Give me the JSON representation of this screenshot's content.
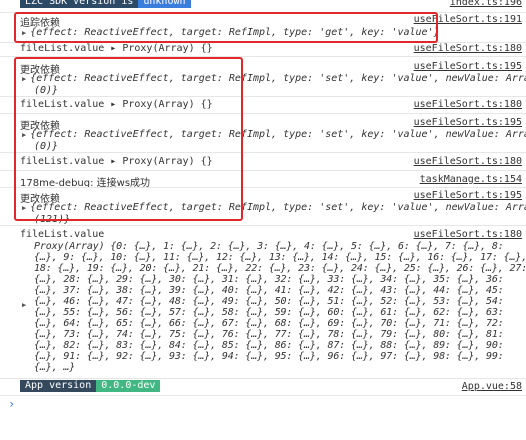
{
  "sdk_banner": {
    "label": "LZC SDK Version is",
    "value": "unknown",
    "link": "index.ts:196"
  },
  "logs": [
    {
      "label": "追踪依赖",
      "obj": "{effect: ReactiveEffect, target: RefImpl, type: 'get', key: 'value'}",
      "link": "useFileSort.ts:191"
    },
    {
      "text": "fileList.value ▸ Proxy(Array) {}",
      "link": "useFileSort.ts:180"
    },
    {
      "label": "更改依赖",
      "obj": "{effect: ReactiveEffect, target: RefImpl, type: 'set', key: 'value', newValue: Array",
      "obj2": "(0)}",
      "link": "useFileSort.ts:195"
    },
    {
      "text": "fileList.value ▸ Proxy(Array) {}",
      "link": "useFileSort.ts:180"
    },
    {
      "label": "更改依赖",
      "obj": "{effect: ReactiveEffect, target: RefImpl, type: 'set', key: 'value', newValue: Array",
      "obj2": "(0)}",
      "link": "useFileSort.ts:195"
    },
    {
      "text": "fileList.value ▸ Proxy(Array) {}",
      "link": "useFileSort.ts:180"
    },
    {
      "text": "178me-debug: 连接ws成功",
      "link": "taskManage.ts:154"
    },
    {
      "label": "更改依赖",
      "obj": "{effect: ReactiveEffect, target: RefImpl, type: 'set', key: 'value', newValue: Array",
      "obj2": "(121)}",
      "link": "useFileSort.ts:195"
    },
    {
      "label": "fileList.value",
      "link": "useFileSort.ts:180"
    }
  ],
  "proxy_lines": [
    "Proxy(Array) {0: {…}, 1: {…}, 2: {…}, 3: {…}, 4: {…}, 5: {…}, 6: {…}, 7: {…}, 8:",
    "{…}, 9: {…}, 10: {…}, 11: {…}, 12: {…}, 13: {…}, 14: {…}, 15: {…}, 16: {…}, 17: {…},",
    "18: {…}, 19: {…}, 20: {…}, 21: {…}, 22: {…}, 23: {…}, 24: {…}, 25: {…}, 26: {…}, 27:",
    "{…}, 28: {…}, 29: {…}, 30: {…}, 31: {…}, 32: {…}, 33: {…}, 34: {…}, 35: {…}, 36:",
    "{…}, 37: {…}, 38: {…}, 39: {…}, 40: {…}, 41: {…}, 42: {…}, 43: {…}, 44: {…}, 45:",
    "{…}, 46: {…}, 47: {…}, 48: {…}, 49: {…}, 50: {…}, 51: {…}, 52: {…}, 53: {…}, 54:",
    "{…}, 55: {…}, 56: {…}, 57: {…}, 58: {…}, 59: {…}, 60: {…}, 61: {…}, 62: {…}, 63:",
    "{…}, 64: {…}, 65: {…}, 66: {…}, 67: {…}, 68: {…}, 69: {…}, 70: {…}, 71: {…}, 72:",
    "{…}, 73: {…}, 74: {…}, 75: {…}, 76: {…}, 77: {…}, 78: {…}, 79: {…}, 80: {…}, 81:",
    "{…}, 82: {…}, 83: {…}, 84: {…}, 85: {…}, 86: {…}, 87: {…}, 88: {…}, 89: {…}, 90:",
    "{…}, 91: {…}, 92: {…}, 93: {…}, 94: {…}, 95: {…}, 96: {…}, 97: {…}, 98: {…}, 99:",
    "{…}, …}"
  ],
  "app_banner": {
    "label": "App version",
    "value": "0.0.0-dev",
    "link": "App.vue:58"
  },
  "prompt": "›",
  "colors": {
    "sdk_label_bg": "#2c4a66",
    "sdk_value_bg": "#3b7ddd",
    "app_label_bg": "#35495e",
    "app_value_bg": "#41b883",
    "highlight": "#e0282b"
  }
}
